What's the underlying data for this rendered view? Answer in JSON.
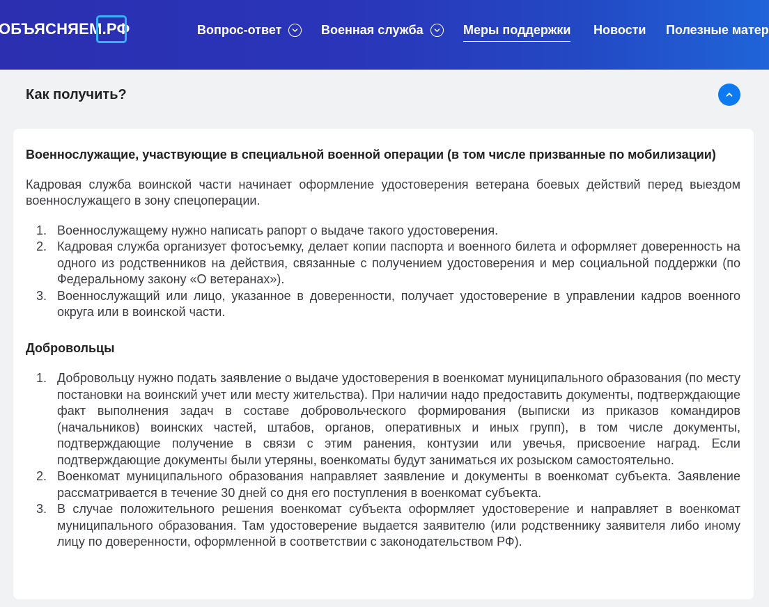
{
  "header": {
    "logo_text": "ОБЪЯСНЯЕМ.РФ",
    "nav": [
      {
        "label": "Вопрос-ответ",
        "has_dropdown": true
      },
      {
        "label": "Военная служба",
        "has_dropdown": true
      },
      {
        "label": "Меры поддержки",
        "active": true
      },
      {
        "label": "Новости"
      },
      {
        "label": "Полезные матер"
      }
    ]
  },
  "accordion": {
    "title": "Как получить?",
    "toggle_icon": "chevron-up-icon"
  },
  "section1": {
    "heading": "Военнослужащие, участвующие в специальной военной операции (в том числе призванные по мобилизации)",
    "intro": "Кадровая служба воинской части начинает оформление удостоверения ветерана боевых действий перед выездом военнослужащего в зону спецоперации.",
    "steps": [
      {
        "num": "1.",
        "text": "Военнослужащему нужно написать рапорт о выдаче такого удостоверения."
      },
      {
        "num": "2.",
        "text": "Кадровая служба организует фотосъемку, делает копии паспорта и военного билета и оформляет доверенность на одного из родственников на действия, связанные с получением удостоверения и мер социальной поддержки (по Федеральному закону «О ветеранах»)."
      },
      {
        "num": "3.",
        "text": "Военнослужащий или лицо, указанное в доверенности, получает удостоверение в управлении кадров военного округа или в воинской части."
      }
    ]
  },
  "section2": {
    "heading": "Добровольцы",
    "steps": [
      {
        "num": "1.",
        "text": "Добровольцу нужно подать заявление о выдаче удостоверения в военкомат муниципального образования (по месту постановки на воинский учет или месту жительства). При наличии надо предоставить документы, подтверждающие факт выполнения задач в составе добровольческого формирования (выписки из приказов командиров (начальников) воинских частей, штабов, органов, оперативных и иных групп), в том числе документы, подтверждающие получение в связи с этим ранения, контузии или увечья, присвоение наград. Если подтверждающие документы были утеряны, военкоматы будут заниматься их розыском самостоятельно."
      },
      {
        "num": "2.",
        "text": "Военкомат муниципального образования направляет заявление и документы в военкомат субъекта. Заявление рассматривается в течение 30 дней со дня его поступления в военкомат субъекта."
      },
      {
        "num": "3.",
        "text": "В случае положительного решения военкомат субъекта оформляет удостоверение и направляет в военкомат муниципального образования. Там удостоверение выдается заявителю (или родственнику заявителя либо иному лицу по доверенности, оформленной в соответствии с законодательством РФ)."
      }
    ]
  },
  "colors": {
    "header_start": "#2b2fb0",
    "header_end": "#1f64d8",
    "accent": "#0d7af2",
    "logo_bubble": "#39b0ff"
  }
}
